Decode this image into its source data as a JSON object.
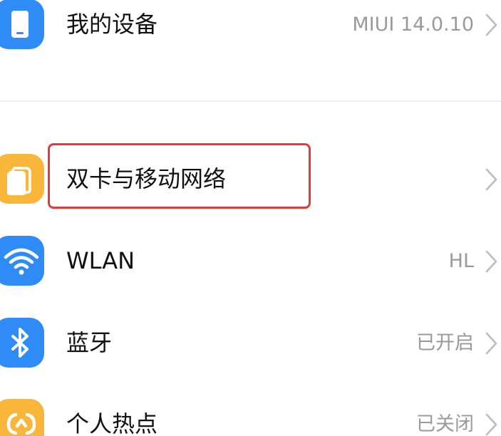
{
  "colors": {
    "device_icon": "#2f8cf7",
    "sim_icon": "#f9b63a",
    "wlan_icon": "#2f8cf7",
    "bluetooth_icon": "#2f8cf7",
    "hotspot_icon": "#f9b63a",
    "highlight_border": "#e23b3b",
    "label_text": "#111111",
    "value_text": "#9a9a9a"
  },
  "settings": {
    "my_device": {
      "label": "我的设备",
      "value": "MIUI 14.0.10",
      "icon": "phone-icon"
    },
    "dual_sim": {
      "label": "双卡与移动网络",
      "value": "",
      "icon": "sim-card-icon"
    },
    "wlan": {
      "label": "WLAN",
      "value": "HL",
      "icon": "wifi-icon"
    },
    "bluetooth": {
      "label": "蓝牙",
      "value": "已开启",
      "icon": "bluetooth-icon"
    },
    "hotspot": {
      "label": "个人热点",
      "value": "已关闭",
      "icon": "hotspot-icon"
    }
  }
}
